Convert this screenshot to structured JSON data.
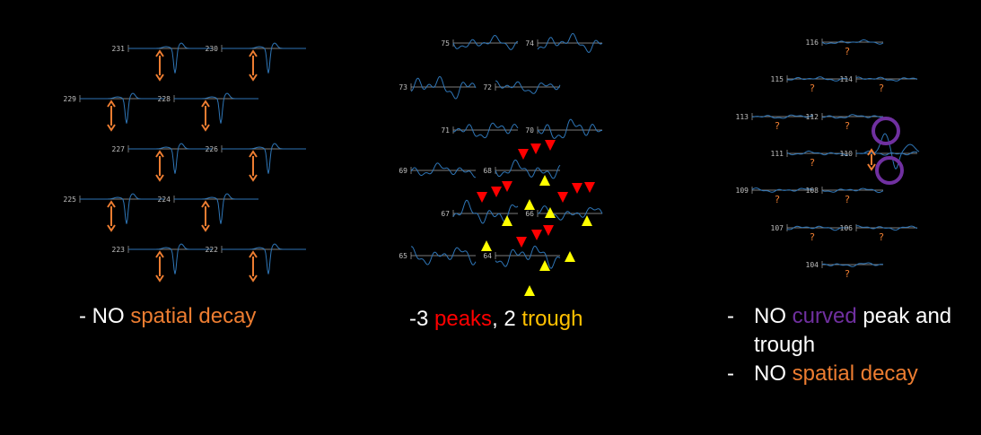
{
  "panels": [
    {
      "name": "left",
      "channels": [
        {
          "id": "231",
          "arrow": true
        },
        {
          "id": "230",
          "arrow": true
        },
        {
          "id": "229",
          "arrow": true
        },
        {
          "id": "228",
          "arrow": true
        },
        {
          "id": "227",
          "arrow": true
        },
        {
          "id": "226",
          "arrow": true
        },
        {
          "id": "225",
          "arrow": true
        },
        {
          "id": "224",
          "arrow": true
        },
        {
          "id": "223",
          "arrow": true
        },
        {
          "id": "222",
          "arrow": true
        }
      ],
      "caption": {
        "prefix": "- NO ",
        "highlight": "spatial decay"
      }
    },
    {
      "name": "middle",
      "channels": [
        {
          "id": "75"
        },
        {
          "id": "74"
        },
        {
          "id": "73"
        },
        {
          "id": "72"
        },
        {
          "id": "71"
        },
        {
          "id": "70"
        },
        {
          "id": "69"
        },
        {
          "id": "68"
        },
        {
          "id": "67"
        },
        {
          "id": "66"
        },
        {
          "id": "65"
        },
        {
          "id": "64"
        }
      ],
      "caption": {
        "prefix": "-3 ",
        "peaks": "peaks",
        "sep": ", 2 ",
        "trough": "trough"
      }
    },
    {
      "name": "right",
      "channels": [
        {
          "id": "116",
          "mark": "?"
        },
        {
          "id": "115",
          "mark": "?"
        },
        {
          "id": "114",
          "mark": "?"
        },
        {
          "id": "113",
          "mark": "?"
        },
        {
          "id": "112",
          "mark": "?"
        },
        {
          "id": "111",
          "mark": "?"
        },
        {
          "id": "110",
          "mark": ""
        },
        {
          "id": "109",
          "mark": "?"
        },
        {
          "id": "108",
          "mark": "?"
        },
        {
          "id": "107",
          "mark": "?"
        },
        {
          "id": "106",
          "mark": "?"
        },
        {
          "id": "104",
          "mark": "?"
        }
      ],
      "caption": {
        "bullet1_prefix": "NO ",
        "bullet1_curved": "curved",
        "bullet1_rest": " peak and",
        "bullet1_cont": "trough",
        "bullet2_prefix": "NO ",
        "bullet2_highlight": "spatial decay"
      }
    }
  ],
  "colors": {
    "trace": "#2E75B6",
    "axis": "#A6A6A6",
    "label": "#BFBFBF",
    "orange": "#ED7D31",
    "red": "#FF0000",
    "yellow": "#FFFF00",
    "purple": "#7030A0"
  }
}
